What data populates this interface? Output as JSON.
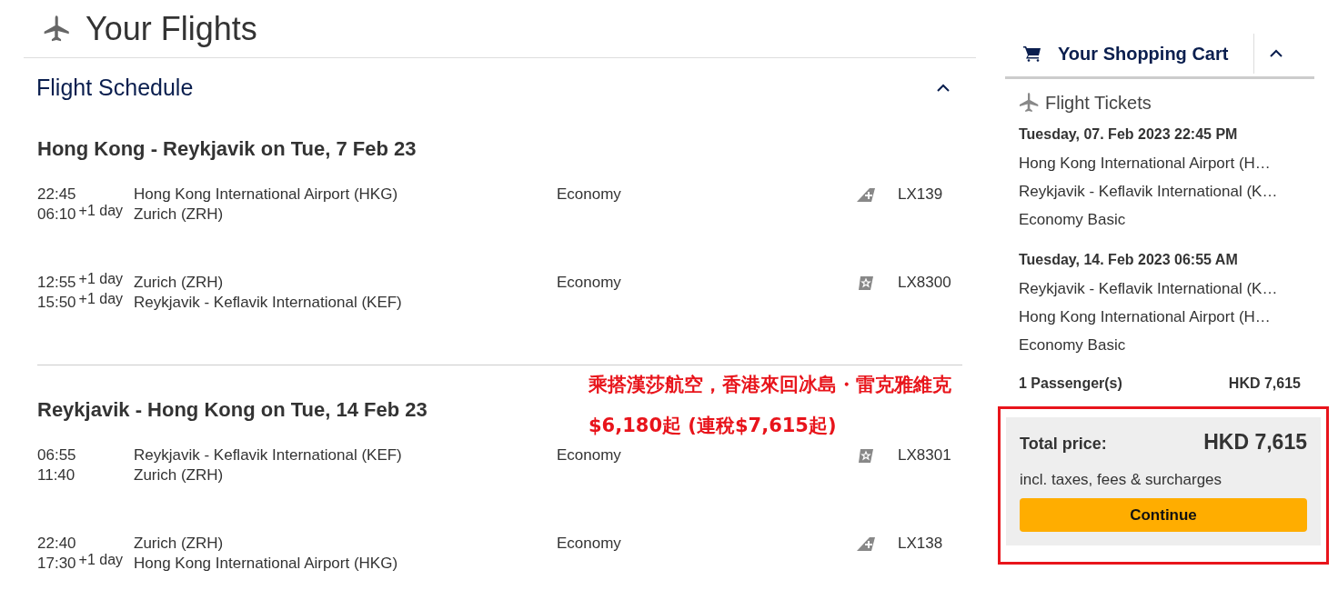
{
  "page_title": "Your Flights",
  "schedule": {
    "title": "Flight Schedule",
    "expanded": true,
    "journeys": [
      {
        "title": "Hong Kong - Reykjavik on Tue, 7 Feb 23",
        "legs": [
          {
            "dep_time": "22:45",
            "arr_time": "06:10",
            "arr_offset": "+1 day",
            "dep_airport": "Hong Kong International Airport (HKG)",
            "arr_airport": "Zurich (ZRH)",
            "cabin": "Economy",
            "kind": "cross",
            "flight": "LX139"
          },
          {
            "dep_time": "12:55",
            "dep_offset": "+1 day",
            "arr_time": "15:50",
            "arr_offset": "+1 day",
            "dep_airport": "Zurich (ZRH)",
            "arr_airport": "Reykjavik - Keflavik International (KEF)",
            "cabin": "Economy",
            "kind": "star",
            "flight": "LX8300"
          }
        ]
      },
      {
        "title": "Reykjavik - Hong Kong on Tue, 14 Feb 23",
        "legs": [
          {
            "dep_time": "06:55",
            "arr_time": "11:40",
            "dep_airport": "Reykjavik - Keflavik International (KEF)",
            "arr_airport": "Zurich (ZRH)",
            "cabin": "Economy",
            "kind": "star",
            "flight": "LX8301"
          },
          {
            "dep_time": "22:40",
            "arr_time": "17:30",
            "arr_offset": "+1 day",
            "dep_airport": "Zurich (ZRH)",
            "arr_airport": "Hong Kong International Airport (HKG)",
            "cabin": "Economy",
            "kind": "cross",
            "flight": "LX138"
          }
        ]
      }
    ]
  },
  "annotation": [
    "乘搭漢莎航空，香港來回冰島・雷克雅維克",
    "$6,180起 (連稅$7,615起)"
  ],
  "cart": {
    "title": "Your Shopping Cart",
    "expanded": true,
    "section": "Flight Tickets",
    "items": [
      {
        "date": "Tuesday, 07. Feb 2023 22:45 PM",
        "from": "Hong Kong International Airport (H…",
        "to": "Reykjavik - Keflavik International (K…",
        "fare": "Economy Basic"
      },
      {
        "date": "Tuesday, 14. Feb 2023 06:55 AM",
        "from": "Reykjavik - Keflavik International (K…",
        "to": "Hong Kong International Airport (H…",
        "fare": "Economy Basic"
      }
    ],
    "passengers": "1 Passenger(s)",
    "passengers_price": "HKD 7,615",
    "total_label": "Total price:",
    "total": "HKD 7,615",
    "total_note": "incl. taxes, fees & surcharges",
    "highlighted": true,
    "button": "Continue"
  }
}
